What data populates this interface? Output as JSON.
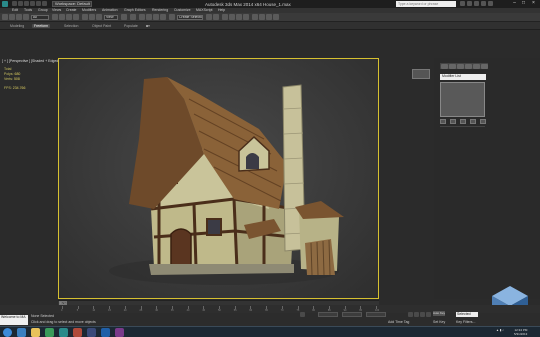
{
  "app": {
    "title": "Autodesk 3ds Max  2014 x64     House_1.max",
    "workspace": "Workspace: Default",
    "search_placeholder": "Type a keyword or phrase"
  },
  "menu": [
    "Edit",
    "Tools",
    "Group",
    "Views",
    "Create",
    "Modifiers",
    "Animation",
    "Graph Editors",
    "Rendering",
    "Customize",
    "MAXScript",
    "Help"
  ],
  "toolbar": {
    "selection_filter": "All",
    "reference_coord": "View",
    "selection_set": "Create Selection Se"
  },
  "ribbon_tabs": [
    {
      "label": "Modeling",
      "active": false
    },
    {
      "label": "Freeform",
      "active": true
    },
    {
      "label": "Selection",
      "active": false
    },
    {
      "label": "Object Paint",
      "active": false
    },
    {
      "label": "Populate",
      "active": false
    }
  ],
  "viewport": {
    "label": "[ + ] [Perspective ] [Shaded + Edged Faces ]",
    "stats": [
      {
        "key": "Total",
        "value": ""
      },
      {
        "key": "Polys:",
        "value": "680"
      },
      {
        "key": "Verts:",
        "value": "508"
      },
      {
        "key": "FPS:",
        "value": "234.766"
      }
    ]
  },
  "command_panel": {
    "modifier_list": "Modifier List"
  },
  "timeline": {
    "frame": "0 / 100",
    "ticks": [
      "0",
      "5",
      "10",
      "15",
      "20",
      "25",
      "30",
      "35",
      "40",
      "45",
      "50",
      "55",
      "60",
      "65",
      "70",
      "75",
      "80",
      "85",
      "90",
      "95",
      "100"
    ]
  },
  "status": {
    "maxscript_line1": "Welcome to MA",
    "maxscript_line2": "",
    "none_selected": "None Selected",
    "prompt": "Click and drag to select and move objects",
    "add_time_tag": "Add Time Tag",
    "auto_key": "Auto Key",
    "set_key": "Set Key",
    "selected": "Selected",
    "key_filters": "Key Filters..."
  },
  "taskbar": {
    "time": "12:34 PM",
    "date": "5/31/2013"
  },
  "colors": {
    "viewport_border": "#d6c030",
    "stats_text": "#e0d060",
    "taskbar_bg": "#1c2833"
  }
}
